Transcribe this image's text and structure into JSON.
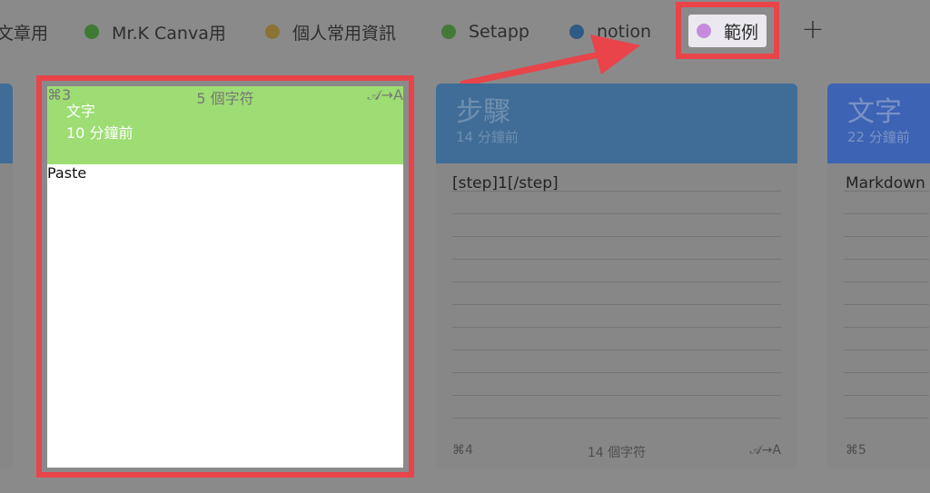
{
  "tabs": [
    {
      "label": "文章用",
      "dot_color": null
    },
    {
      "label": "Mr.K Canva用",
      "dot_color": "#3f7a33"
    },
    {
      "label": "個人常用資訊",
      "dot_color": "#8a7335"
    },
    {
      "label": "Setapp",
      "dot_color": "#437a37"
    },
    {
      "label": "notion",
      "dot_color": "#2f5a83"
    },
    {
      "label": "範例",
      "dot_color": "#c68bdc",
      "active": true
    }
  ],
  "add_tab_label": "+",
  "cards": [
    {
      "title": "文字",
      "time": "10 分鐘前",
      "content": "Paste",
      "shortcut": "⌘3",
      "char_count": "5 個字符",
      "transform": "𝒜→A",
      "header_color": "#9ddd73",
      "selected": true
    },
    {
      "title": "步驟",
      "time": "14 分鐘前",
      "content": "[step]1[/step]",
      "shortcut": "⌘4",
      "char_count": "14 個字符",
      "transform": "𝒜→A",
      "header_color": "#3f6d98"
    },
    {
      "title": "文字",
      "time": "22 分鐘前",
      "content": "Markdown",
      "shortcut": "⌘5",
      "char_count": "",
      "transform": "",
      "header_color": "#3c63b4"
    }
  ],
  "colors": {
    "highlight": "#e8444a",
    "background": "#8a8a8a"
  }
}
